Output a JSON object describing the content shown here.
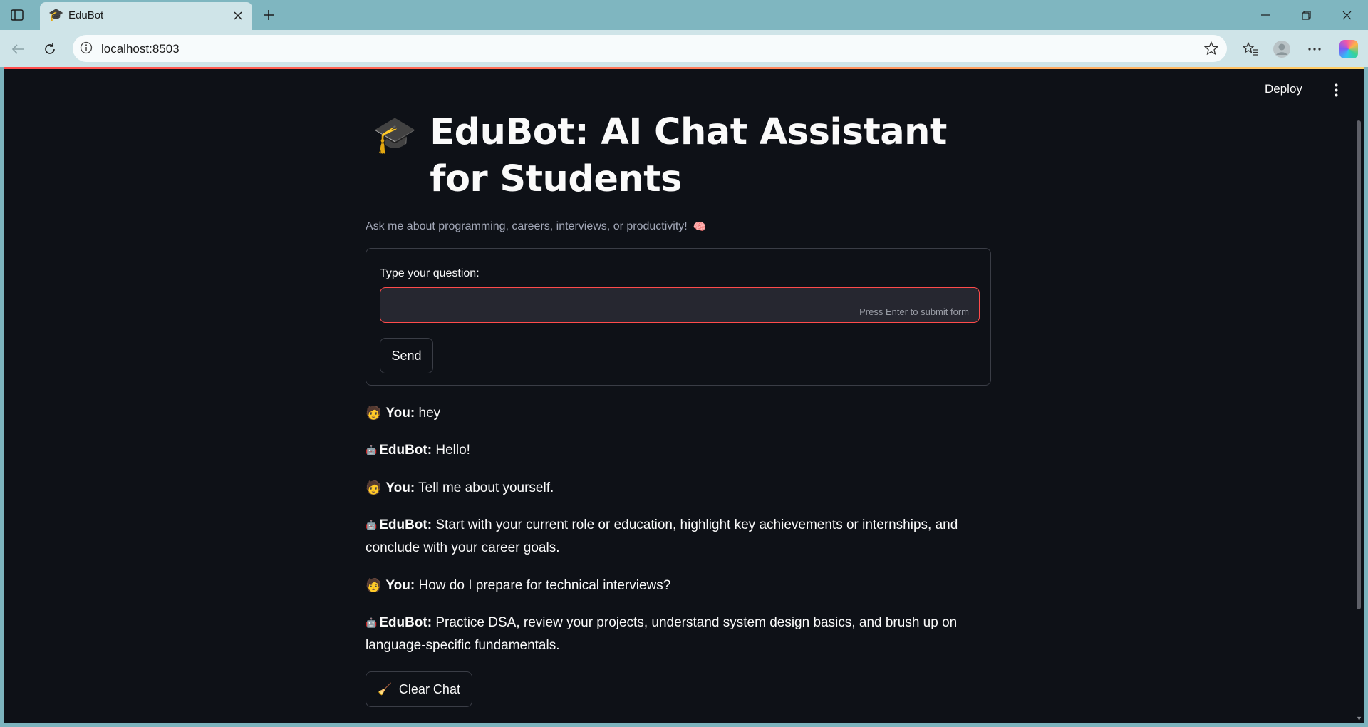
{
  "browser": {
    "tab_title": "EduBot",
    "tab_favicon": "🎓",
    "url": "localhost:8503",
    "icons": {
      "sidebar": "sidebar-toggle-icon",
      "close": "close-icon",
      "new_tab": "plus-icon",
      "back": "back-arrow-icon",
      "reload": "reload-icon",
      "info": "info-icon",
      "favorite": "star-icon",
      "favorites": "favorites-icon",
      "profile": "profile-icon",
      "more": "more-icon",
      "copilot": "copilot-icon"
    }
  },
  "app": {
    "deploy_label": "Deploy",
    "title_emoji": "🎓",
    "title": "EduBot: AI Chat Assistant for Students",
    "subtitle": "Ask me about programming, careers, interviews, or productivity!",
    "subtitle_emoji": "🧠",
    "form": {
      "label": "Type your question:",
      "input_value": "",
      "hint": "Press Enter to submit form",
      "send_label": "Send"
    },
    "chat": [
      {
        "emoji": "🧑",
        "speaker": "You:",
        "text": "hey",
        "role": "user"
      },
      {
        "emoji": "🤖",
        "speaker": "EduBot:",
        "text": "Hello!",
        "role": "bot"
      },
      {
        "emoji": "🧑",
        "speaker": "You:",
        "text": "Tell me about yourself.",
        "role": "user"
      },
      {
        "emoji": "🤖",
        "speaker": "EduBot:",
        "text": "Start with your current role or education, highlight key achievements or internships, and conclude with your career goals.",
        "role": "bot"
      },
      {
        "emoji": "🧑",
        "speaker": "You:",
        "text": "How do I prepare for technical interviews?",
        "role": "user"
      },
      {
        "emoji": "🤖",
        "speaker": "EduBot:",
        "text": "Practice DSA, review your projects, understand system design basics, and brush up on language-specific fundamentals.",
        "role": "bot"
      }
    ],
    "clear_emoji": "🧹",
    "clear_label": "Clear Chat",
    "accent_color": "#ff4b4b",
    "background_color": "#0e1117"
  }
}
